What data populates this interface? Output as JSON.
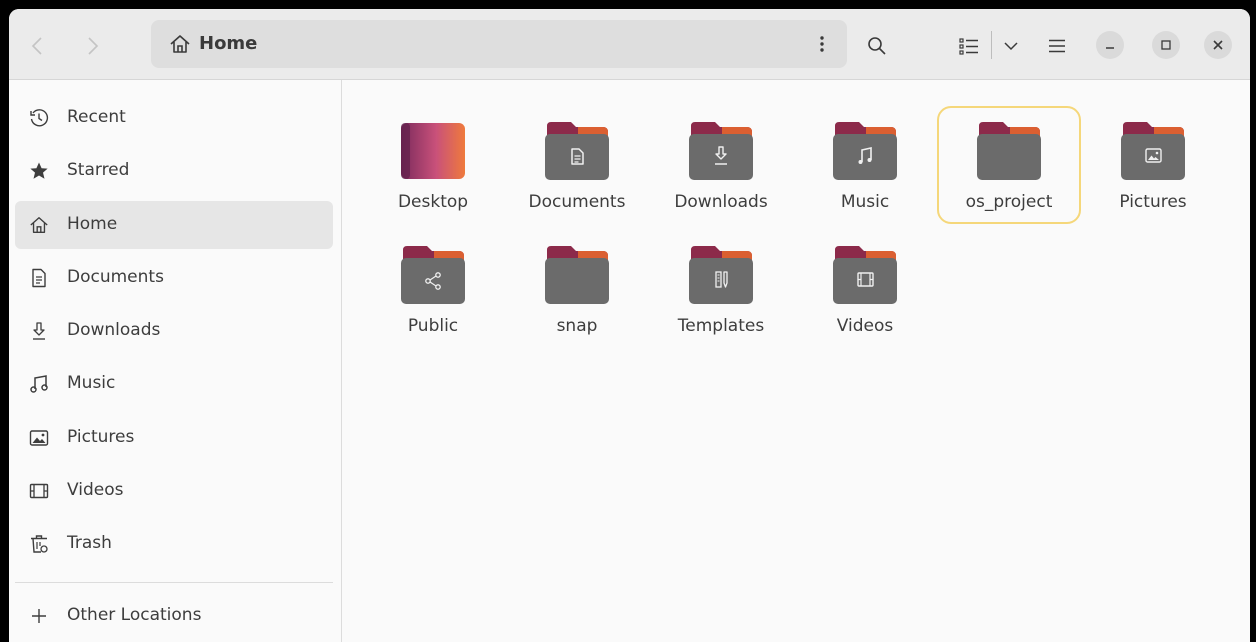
{
  "header": {
    "path_label": "Home"
  },
  "sidebar": {
    "items": [
      {
        "label": "Recent",
        "icon": "clock-icon"
      },
      {
        "label": "Starred",
        "icon": "star-icon"
      },
      {
        "label": "Home",
        "icon": "home-icon"
      },
      {
        "label": "Documents",
        "icon": "document-icon"
      },
      {
        "label": "Downloads",
        "icon": "download-icon"
      },
      {
        "label": "Music",
        "icon": "music-note-icon"
      },
      {
        "label": "Pictures",
        "icon": "picture-icon"
      },
      {
        "label": "Videos",
        "icon": "film-icon"
      },
      {
        "label": "Trash",
        "icon": "trash-icon"
      }
    ],
    "other_locations": "Other Locations"
  },
  "files": [
    {
      "name": "Desktop",
      "icon": "desktop-folder-icon"
    },
    {
      "name": "Documents",
      "icon": "documents-folder-icon"
    },
    {
      "name": "Downloads",
      "icon": "downloads-folder-icon"
    },
    {
      "name": "Music",
      "icon": "music-folder-icon"
    },
    {
      "name": "os_project",
      "icon": "folder-icon"
    },
    {
      "name": "Pictures",
      "icon": "pictures-folder-icon"
    },
    {
      "name": "Public",
      "icon": "public-folder-icon"
    },
    {
      "name": "snap",
      "icon": "folder-icon"
    },
    {
      "name": "Templates",
      "icon": "templates-folder-icon"
    },
    {
      "name": "Videos",
      "icon": "videos-folder-icon"
    }
  ],
  "selected_file": "os_project",
  "colors": {
    "folder_body": "#6b6b6b",
    "folder_tab": "#8c2a4a",
    "folder_tab_accent": "#e3652f",
    "selection_border": "#f5d77a"
  }
}
